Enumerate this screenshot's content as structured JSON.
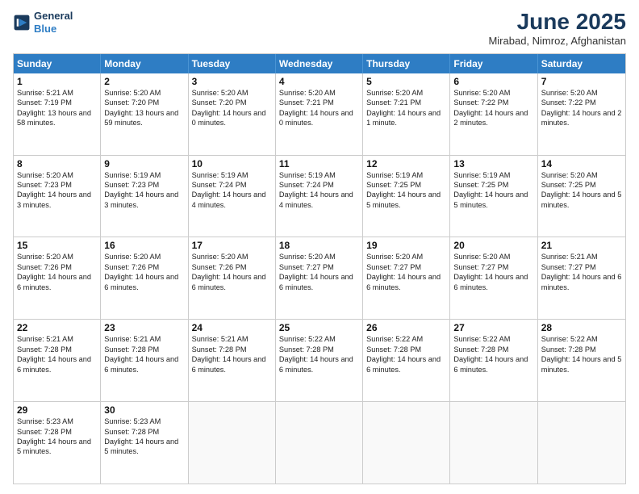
{
  "header": {
    "logo_line1": "General",
    "logo_line2": "Blue",
    "month": "June 2025",
    "location": "Mirabad, Nimroz, Afghanistan"
  },
  "weekdays": [
    "Sunday",
    "Monday",
    "Tuesday",
    "Wednesday",
    "Thursday",
    "Friday",
    "Saturday"
  ],
  "rows": [
    [
      {
        "day": "",
        "empty": true
      },
      {
        "day": "2",
        "sr": "Sunrise: 5:20 AM",
        "ss": "Sunset: 7:20 PM",
        "dl": "Daylight: 13 hours and 59 minutes."
      },
      {
        "day": "3",
        "sr": "Sunrise: 5:20 AM",
        "ss": "Sunset: 7:20 PM",
        "dl": "Daylight: 14 hours and 0 minutes."
      },
      {
        "day": "4",
        "sr": "Sunrise: 5:20 AM",
        "ss": "Sunset: 7:21 PM",
        "dl": "Daylight: 14 hours and 0 minutes."
      },
      {
        "day": "5",
        "sr": "Sunrise: 5:20 AM",
        "ss": "Sunset: 7:21 PM",
        "dl": "Daylight: 14 hours and 1 minute."
      },
      {
        "day": "6",
        "sr": "Sunrise: 5:20 AM",
        "ss": "Sunset: 7:22 PM",
        "dl": "Daylight: 14 hours and 2 minutes."
      },
      {
        "day": "7",
        "sr": "Sunrise: 5:20 AM",
        "ss": "Sunset: 7:22 PM",
        "dl": "Daylight: 14 hours and 2 minutes."
      }
    ],
    [
      {
        "day": "1",
        "sr": "Sunrise: 5:21 AM",
        "ss": "Sunset: 7:19 PM",
        "dl": "Daylight: 13 hours and 58 minutes.",
        "first_row_sunday": true
      },
      {
        "day": "9",
        "sr": "Sunrise: 5:19 AM",
        "ss": "Sunset: 7:23 PM",
        "dl": "Daylight: 14 hours and 3 minutes."
      },
      {
        "day": "10",
        "sr": "Sunrise: 5:19 AM",
        "ss": "Sunset: 7:24 PM",
        "dl": "Daylight: 14 hours and 4 minutes."
      },
      {
        "day": "11",
        "sr": "Sunrise: 5:19 AM",
        "ss": "Sunset: 7:24 PM",
        "dl": "Daylight: 14 hours and 4 minutes."
      },
      {
        "day": "12",
        "sr": "Sunrise: 5:19 AM",
        "ss": "Sunset: 7:25 PM",
        "dl": "Daylight: 14 hours and 5 minutes."
      },
      {
        "day": "13",
        "sr": "Sunrise: 5:19 AM",
        "ss": "Sunset: 7:25 PM",
        "dl": "Daylight: 14 hours and 5 minutes."
      },
      {
        "day": "14",
        "sr": "Sunrise: 5:20 AM",
        "ss": "Sunset: 7:25 PM",
        "dl": "Daylight: 14 hours and 5 minutes."
      }
    ],
    [
      {
        "day": "8",
        "sr": "Sunrise: 5:20 AM",
        "ss": "Sunset: 7:23 PM",
        "dl": "Daylight: 14 hours and 3 minutes."
      },
      {
        "day": "16",
        "sr": "Sunrise: 5:20 AM",
        "ss": "Sunset: 7:26 PM",
        "dl": "Daylight: 14 hours and 6 minutes."
      },
      {
        "day": "17",
        "sr": "Sunrise: 5:20 AM",
        "ss": "Sunset: 7:26 PM",
        "dl": "Daylight: 14 hours and 6 minutes."
      },
      {
        "day": "18",
        "sr": "Sunrise: 5:20 AM",
        "ss": "Sunset: 7:27 PM",
        "dl": "Daylight: 14 hours and 6 minutes."
      },
      {
        "day": "19",
        "sr": "Sunrise: 5:20 AM",
        "ss": "Sunset: 7:27 PM",
        "dl": "Daylight: 14 hours and 6 minutes."
      },
      {
        "day": "20",
        "sr": "Sunrise: 5:20 AM",
        "ss": "Sunset: 7:27 PM",
        "dl": "Daylight: 14 hours and 6 minutes."
      },
      {
        "day": "21",
        "sr": "Sunrise: 5:21 AM",
        "ss": "Sunset: 7:27 PM",
        "dl": "Daylight: 14 hours and 6 minutes."
      }
    ],
    [
      {
        "day": "15",
        "sr": "Sunrise: 5:20 AM",
        "ss": "Sunset: 7:26 PM",
        "dl": "Daylight: 14 hours and 6 minutes."
      },
      {
        "day": "23",
        "sr": "Sunrise: 5:21 AM",
        "ss": "Sunset: 7:28 PM",
        "dl": "Daylight: 14 hours and 6 minutes."
      },
      {
        "day": "24",
        "sr": "Sunrise: 5:21 AM",
        "ss": "Sunset: 7:28 PM",
        "dl": "Daylight: 14 hours and 6 minutes."
      },
      {
        "day": "25",
        "sr": "Sunrise: 5:22 AM",
        "ss": "Sunset: 7:28 PM",
        "dl": "Daylight: 14 hours and 6 minutes."
      },
      {
        "day": "26",
        "sr": "Sunrise: 5:22 AM",
        "ss": "Sunset: 7:28 PM",
        "dl": "Daylight: 14 hours and 6 minutes."
      },
      {
        "day": "27",
        "sr": "Sunrise: 5:22 AM",
        "ss": "Sunset: 7:28 PM",
        "dl": "Daylight: 14 hours and 6 minutes."
      },
      {
        "day": "28",
        "sr": "Sunrise: 5:22 AM",
        "ss": "Sunset: 7:28 PM",
        "dl": "Daylight: 14 hours and 5 minutes."
      }
    ],
    [
      {
        "day": "22",
        "sr": "Sunrise: 5:21 AM",
        "ss": "Sunset: 7:28 PM",
        "dl": "Daylight: 14 hours and 6 minutes."
      },
      {
        "day": "30",
        "sr": "Sunrise: 5:23 AM",
        "ss": "Sunset: 7:28 PM",
        "dl": "Daylight: 14 hours and 5 minutes."
      },
      {
        "day": "",
        "empty": true
      },
      {
        "day": "",
        "empty": true
      },
      {
        "day": "",
        "empty": true
      },
      {
        "day": "",
        "empty": true
      },
      {
        "day": "",
        "empty": true
      }
    ],
    [
      {
        "day": "29",
        "sr": "Sunrise: 5:23 AM",
        "ss": "Sunset: 7:28 PM",
        "dl": "Daylight: 14 hours and 5 minutes."
      },
      {
        "day": "",
        "empty": true
      },
      {
        "day": "",
        "empty": true
      },
      {
        "day": "",
        "empty": true
      },
      {
        "day": "",
        "empty": true
      },
      {
        "day": "",
        "empty": true
      },
      {
        "day": "",
        "empty": true
      }
    ]
  ]
}
